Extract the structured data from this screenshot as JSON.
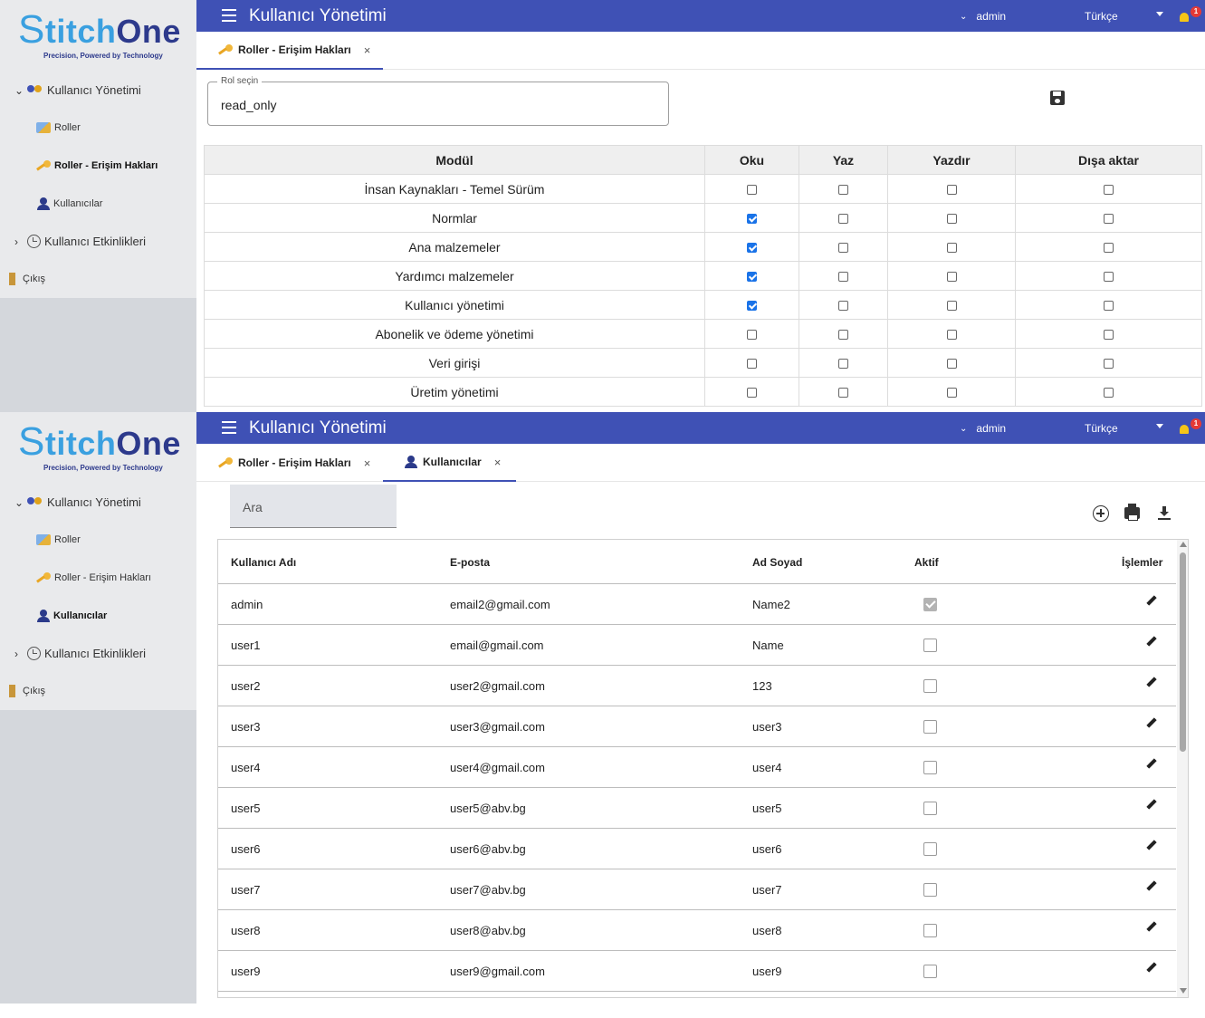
{
  "brand": {
    "logo_s": "S",
    "logo_tch": "titch",
    "logo_one": "One",
    "tagline": "Precision, Powered by Technology"
  },
  "sidebar": {
    "group": "Kullanıcı Yönetimi",
    "items": [
      {
        "label": "Roller"
      },
      {
        "label": "Roller - Erişim Hakları"
      },
      {
        "label": "Kullanıcılar"
      }
    ],
    "activity": "Kullanıcı Etkinlikleri",
    "logout": "Çıkış"
  },
  "header": {
    "title": "Kullanıcı Yönetimi",
    "user": "admin",
    "language": "Türkçe",
    "notif_count": "1"
  },
  "panel1": {
    "tabs": [
      {
        "label": "Roller - Erişim Hakları",
        "close": "×"
      }
    ],
    "role_select": {
      "label": "Rol seçin",
      "value": "read_only"
    },
    "columns": [
      "Modül",
      "Oku",
      "Yaz",
      "Yazdır",
      "Dışa aktar"
    ],
    "modules": [
      {
        "name": "İnsan Kaynakları - Temel Sürüm",
        "perms": [
          false,
          false,
          false,
          false
        ]
      },
      {
        "name": "Normlar",
        "perms": [
          true,
          false,
          false,
          false
        ]
      },
      {
        "name": "Ana malzemeler",
        "perms": [
          true,
          false,
          false,
          false
        ]
      },
      {
        "name": "Yardımcı malzemeler",
        "perms": [
          true,
          false,
          false,
          false
        ]
      },
      {
        "name": "Kullanıcı yönetimi",
        "perms": [
          true,
          false,
          false,
          false
        ]
      },
      {
        "name": "Abonelik ve ödeme yönetimi",
        "perms": [
          false,
          false,
          false,
          false
        ]
      },
      {
        "name": "Veri girişi",
        "perms": [
          false,
          false,
          false,
          false
        ]
      },
      {
        "name": "Üretim yönetimi",
        "perms": [
          false,
          false,
          false,
          false
        ]
      }
    ]
  },
  "panel2": {
    "tabs": [
      {
        "label": "Roller - Erişim Hakları",
        "close": "×"
      },
      {
        "label": "Kullanıcılar",
        "close": "×"
      }
    ],
    "search_placeholder": "Ara",
    "columns": [
      "Kullanıcı Adı",
      "E-posta",
      "Ad Soyad",
      "Aktif",
      "İşlemler"
    ],
    "users": [
      {
        "username": "admin",
        "email": "email2@gmail.com",
        "name": "Name2",
        "active": true
      },
      {
        "username": "user1",
        "email": "email@gmail.com",
        "name": "Name",
        "active": false
      },
      {
        "username": "user2",
        "email": "user2@gmail.com",
        "name": "123",
        "active": false
      },
      {
        "username": "user3",
        "email": "user3@gmail.com",
        "name": "user3",
        "active": false
      },
      {
        "username": "user4",
        "email": "user4@gmail.com",
        "name": "user4",
        "active": false
      },
      {
        "username": "user5",
        "email": "user5@abv.bg",
        "name": "user5",
        "active": false
      },
      {
        "username": "user6",
        "email": "user6@abv.bg",
        "name": "user6",
        "active": false
      },
      {
        "username": "user7",
        "email": "user7@abv.bg",
        "name": "user7",
        "active": false
      },
      {
        "username": "user8",
        "email": "user8@abv.bg",
        "name": "user8",
        "active": false
      },
      {
        "username": "user9",
        "email": "user9@gmail.com",
        "name": "user9",
        "active": false
      }
    ]
  }
}
